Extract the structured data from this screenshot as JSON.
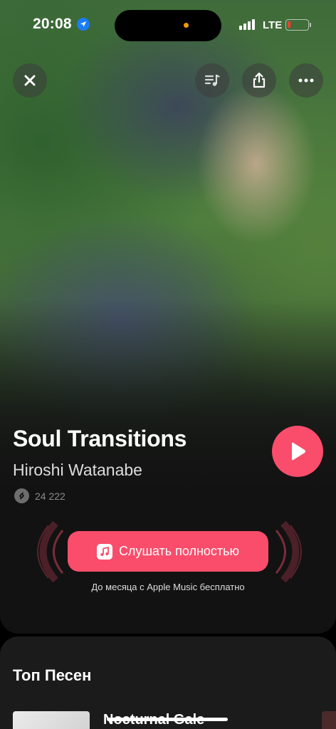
{
  "status_bar": {
    "time": "20:08",
    "network": "LTE",
    "location_icon": "location-arrow-icon",
    "battery_color": "#ff3b30"
  },
  "top_buttons": {
    "close_icon": "close-icon",
    "queue_icon": "music-queue-icon",
    "share_icon": "share-icon",
    "more_icon": "more-icon"
  },
  "track": {
    "title": "Soul Transitions",
    "artist": "Hiroshi Watanabe",
    "shazam_count": "24 222"
  },
  "listen": {
    "label": "Слушать полностью",
    "note": "До месяца с Apple Music бесплатно"
  },
  "top_songs": {
    "title": "Топ Песен",
    "items": [
      {
        "title": "Nocturnal Gale"
      }
    ]
  },
  "colors": {
    "accent": "#fa4d6b",
    "background": "#121212",
    "sheet": "#1b1b1b"
  }
}
